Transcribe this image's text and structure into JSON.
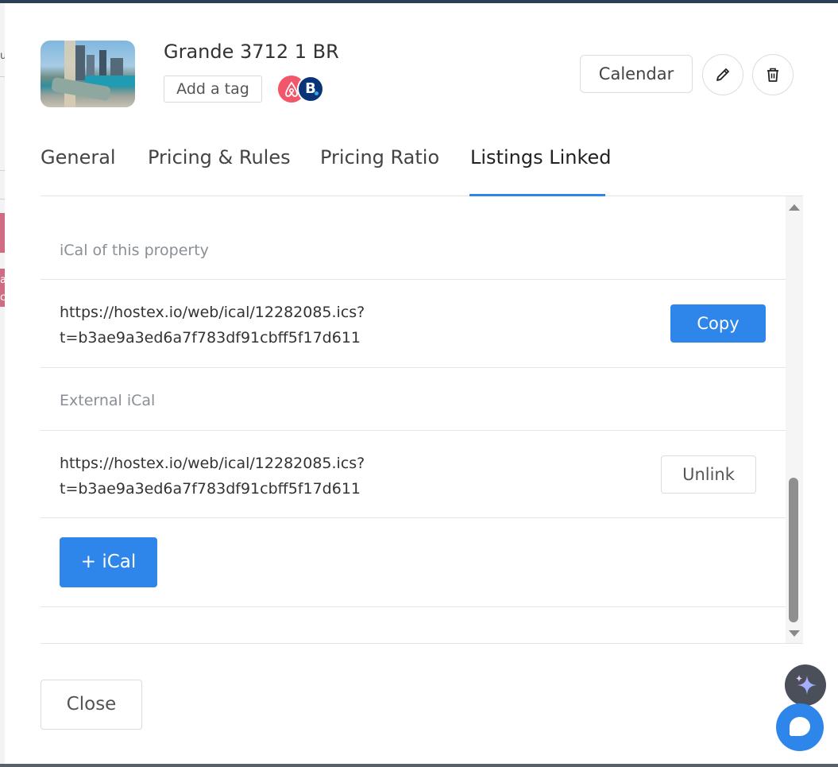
{
  "property": {
    "title": "Grande 3712 1 BR",
    "add_tag_label": "Add a tag",
    "channels": [
      "airbnb-icon",
      "booking-icon"
    ]
  },
  "header": {
    "calendar_label": "Calendar"
  },
  "background_fragments": [
    "u",
    "a",
    "c"
  ],
  "tabs": [
    {
      "label": "General",
      "active": false
    },
    {
      "label": "Pricing & Rules",
      "active": false
    },
    {
      "label": "Pricing Ratio",
      "active": false
    },
    {
      "label": "Listings Linked",
      "active": true
    }
  ],
  "ical_of_property": {
    "label": "iCal of this property",
    "url_line1": "https://hostex.io/web/ical/12282085.ics?",
    "url_line2": "t=b3ae9a3ed6a7f783df91cbff5f17d611",
    "copy_label": "Copy"
  },
  "external_ical": {
    "label": "External iCal",
    "url_line1": "https://hostex.io/web/ical/12282085.ics?",
    "url_line2": "t=b3ae9a3ed6a7f783df91cbff5f17d611",
    "unlink_label": "Unlink"
  },
  "add_ical_label": "+ iCal",
  "footer": {
    "close_label": "Close"
  },
  "colors": {
    "primary": "#2e86ea",
    "airbnb": "#f2566a",
    "booking": "#0a3478"
  }
}
